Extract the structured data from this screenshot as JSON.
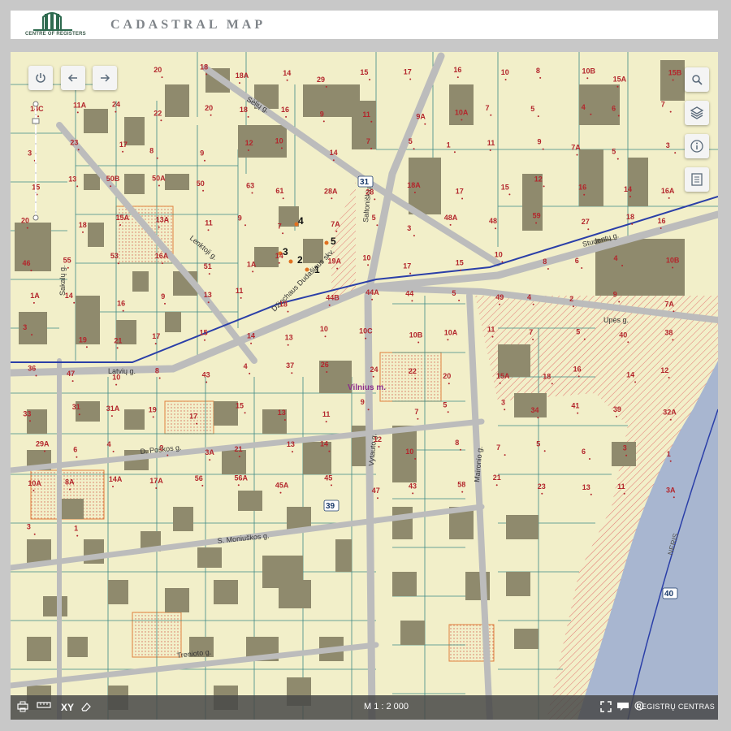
{
  "header": {
    "logo_text": "CENTRE OF REGISTERS",
    "title": "CADASTRAL MAP"
  },
  "map": {
    "place_label": "Vilnius m.",
    "river_label": "NERIS",
    "streets": [
      "Sėlių g.",
      "Lenktoji g.",
      "Saltoniškių g.",
      "Sakalų g.",
      "Džiochaus Dudašiaus skv.",
      "Studentų g.",
      "Upės g.",
      "Latvių g.",
      "D. Poškos g.",
      "Vytauto g.",
      "Maironio g.",
      "S. Moniuškos g.",
      "Trenioto g."
    ],
    "road_shields": [
      "31",
      "39",
      "40"
    ],
    "marked_points": [
      "1",
      "2",
      "3",
      "4",
      "5"
    ],
    "parcel_numbers": [
      "5A",
      "3A",
      "22",
      "20",
      "18",
      "18A",
      "14",
      "29",
      "15",
      "17",
      "16",
      "10",
      "8",
      "10B",
      "15A",
      "15B",
      "14C",
      "11A",
      "24",
      "22",
      "20",
      "18",
      "16",
      "9",
      "11",
      "9A",
      "10A",
      "7",
      "5",
      "4",
      "6",
      "7",
      "3",
      "23",
      "17",
      "8",
      "9",
      "12",
      "10",
      "14",
      "7",
      "5",
      "1",
      "11",
      "9",
      "7A",
      "5",
      "3",
      "15",
      "13",
      "50B",
      "50A",
      "50",
      "63",
      "61",
      "28A",
      "28",
      "18A",
      "17",
      "15",
      "12",
      "16",
      "14",
      "16A",
      "20",
      "18",
      "15A",
      "13A",
      "11",
      "9",
      "7",
      "7A",
      "5",
      "3",
      "48A",
      "48",
      "59",
      "27",
      "18",
      "16",
      "46",
      "55",
      "53",
      "16A",
      "51",
      "1A",
      "14",
      "19A",
      "10",
      "17",
      "15",
      "10",
      "8",
      "6",
      "4",
      "10B",
      "1A",
      "14",
      "16",
      "9",
      "13",
      "11",
      "18",
      "44B",
      "44A",
      "44",
      "5",
      "49",
      "4",
      "2",
      "9",
      "7A",
      "3",
      "19",
      "21",
      "17",
      "15",
      "14",
      "13",
      "10",
      "10C",
      "10B",
      "10A",
      "11",
      "7",
      "5",
      "40",
      "38",
      "36",
      "47",
      "10",
      "8",
      "43",
      "4",
      "37",
      "26",
      "24",
      "22",
      "20",
      "15A",
      "18",
      "16",
      "14",
      "12",
      "33",
      "31",
      "31A",
      "19",
      "17",
      "15",
      "13",
      "11",
      "9",
      "7",
      "5",
      "3",
      "34",
      "41",
      "39",
      "32A",
      "29A",
      "6",
      "4",
      "2",
      "3A",
      "21",
      "13",
      "14",
      "12",
      "10",
      "8",
      "7",
      "5",
      "6",
      "3",
      "1",
      "10A",
      "8A",
      "14A",
      "17A",
      "56",
      "56A",
      "45A",
      "45",
      "47",
      "43",
      "58",
      "21",
      "23",
      "13",
      "11",
      "3A",
      "3",
      "1"
    ],
    "scale": "M 1 : 2 000",
    "credit": "REGISTRŲ CENTRAS"
  },
  "controls": {
    "top_left": [
      "power-icon",
      "undo-icon",
      "redo-icon"
    ],
    "top_right": [
      "search-icon",
      "layers-icon",
      "info-icon",
      "legend-icon"
    ],
    "bottom": [
      "print-icon",
      "measure-icon",
      "xy-label",
      "eraser-icon"
    ],
    "bottom_xy": "XY",
    "bottom_right": [
      "fullscreen-icon",
      "chat-icon",
      "copyright-icon"
    ]
  },
  "colors": {
    "parcel_fill": "#f2efc9",
    "building": "#8f8a6d",
    "parcel_border": "#3e8a86",
    "road": "#bdbdbd",
    "boundary_blue": "#2b3fa8",
    "water": "#a8b6d0",
    "hatch": "#e06666"
  }
}
